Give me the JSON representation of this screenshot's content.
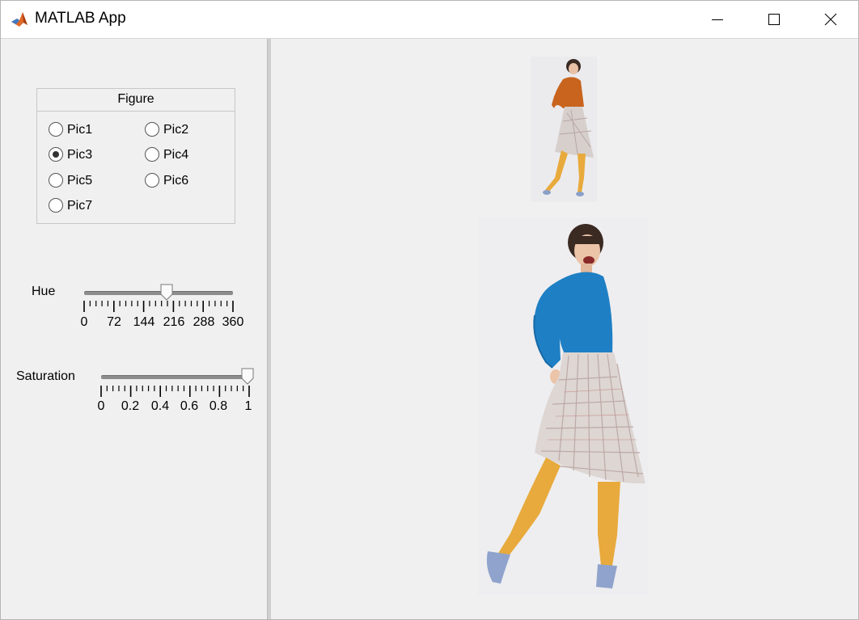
{
  "window": {
    "title": "MATLAB App",
    "controls": [
      "minimize-icon",
      "maximize-icon",
      "close-icon"
    ]
  },
  "figure_group": {
    "title": "Figure",
    "options": [
      {
        "label": "Pic1",
        "selected": false
      },
      {
        "label": "Pic2",
        "selected": false
      },
      {
        "label": "Pic3",
        "selected": true
      },
      {
        "label": "Pic4",
        "selected": false
      },
      {
        "label": "Pic5",
        "selected": false
      },
      {
        "label": "Pic6",
        "selected": false
      },
      {
        "label": "Pic7",
        "selected": false
      }
    ]
  },
  "hue_slider": {
    "label": "Hue",
    "value": 185,
    "min": 0,
    "max": 360,
    "tick_labels": [
      "0",
      "72",
      "144",
      "216",
      "288",
      "360"
    ]
  },
  "saturation_slider": {
    "label": "Saturation",
    "value": 1,
    "min": 0,
    "max": 1,
    "tick_labels": [
      "0",
      "0.2",
      "0.4",
      "0.6",
      "0.8",
      "1"
    ]
  },
  "images": {
    "original": {
      "sweater_color": "#c8641e",
      "tights_color": "#e8aa3c"
    },
    "adjusted": {
      "sweater_color": "#1e7fc4",
      "tights_color": "#e8aa3c"
    }
  }
}
